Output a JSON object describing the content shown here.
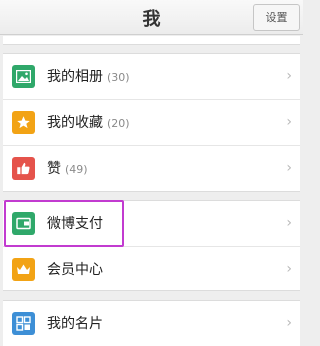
{
  "header": {
    "title": "我",
    "settings_label": "设置"
  },
  "items": [
    {
      "label": "我的相册",
      "count": "(30)",
      "icon": "photo-icon",
      "color": "#2fa86a"
    },
    {
      "label": "我的收藏",
      "count": "(20)",
      "icon": "star-icon",
      "color": "#f2a315"
    },
    {
      "label": "赞",
      "count": "(49)",
      "icon": "thumbs-up-icon",
      "color": "#e5534b"
    },
    {
      "label": "微博支付",
      "count": "",
      "icon": "wallet-icon",
      "color": "#2fa86a"
    },
    {
      "label": "会员中心",
      "count": "",
      "icon": "crown-icon",
      "color": "#f2a315"
    },
    {
      "label": "我的名片",
      "count": "",
      "icon": "card-grid-icon",
      "color": "#3d8fd6"
    }
  ],
  "chevron": "›"
}
